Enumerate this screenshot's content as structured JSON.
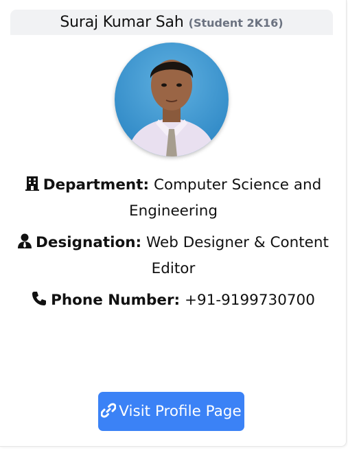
{
  "profile": {
    "name": "Suraj Kumar Sah",
    "subtitle": "(Student 2K16)"
  },
  "details": {
    "department_label": "Department:",
    "department_value": "Computer Science and Engineering",
    "designation_label": "Designation:",
    "designation_value": "Web Designer & Content Editor",
    "phone_label": "Phone Number:",
    "phone_value": "+91-9199730700"
  },
  "actions": {
    "visit_label": "Visit Profile Page"
  },
  "icons": {
    "department": "building-icon",
    "designation": "user-tie-icon",
    "phone": "phone-icon",
    "visit": "link-icon"
  },
  "colors": {
    "header_bg": "#f1f2f4",
    "subtitle": "#6b7280",
    "button_bg": "#3b82f6",
    "button_text": "#ffffff"
  }
}
